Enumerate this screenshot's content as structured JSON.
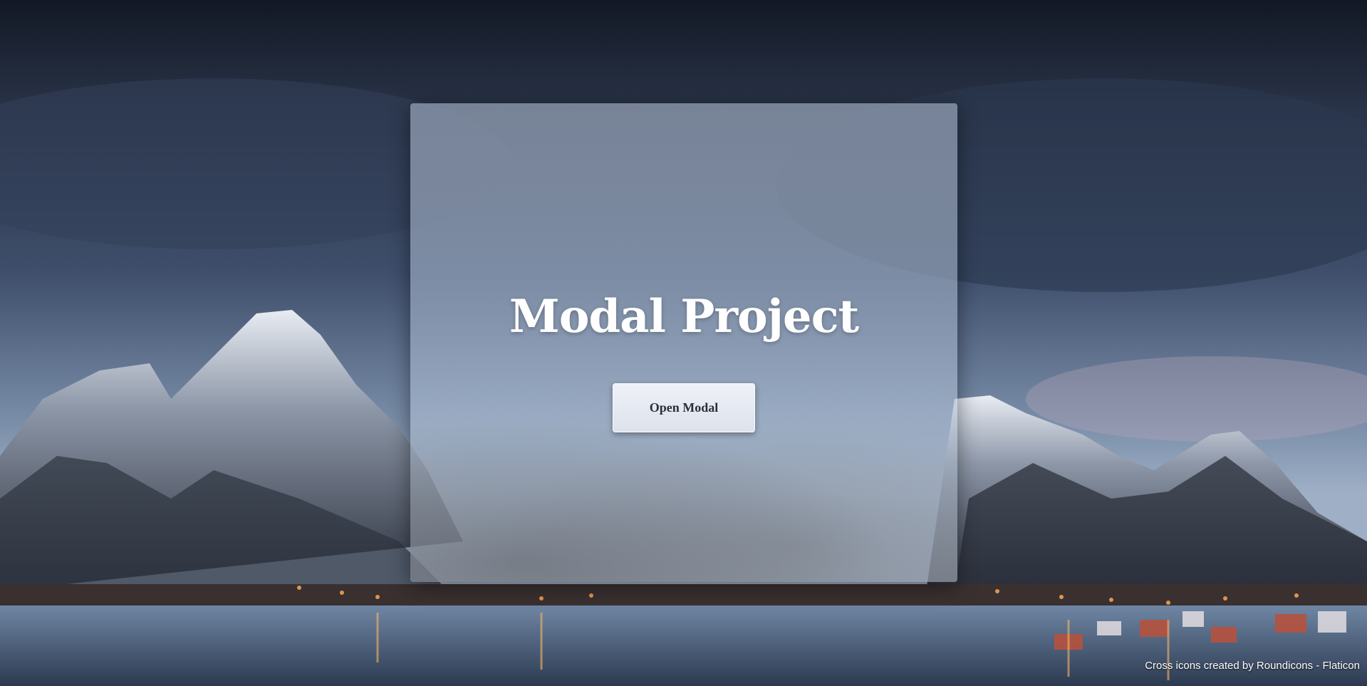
{
  "hero": {
    "title": "Modal Project",
    "open_button_label": "Open Modal"
  },
  "footer": {
    "attribution": "Cross icons created by Roundicons - Flaticon"
  },
  "colors": {
    "card_glass": "#a4b2c8",
    "title_text": "#ffffff",
    "button_bg": "#e6eaf2",
    "button_text": "#2a2f3a"
  }
}
